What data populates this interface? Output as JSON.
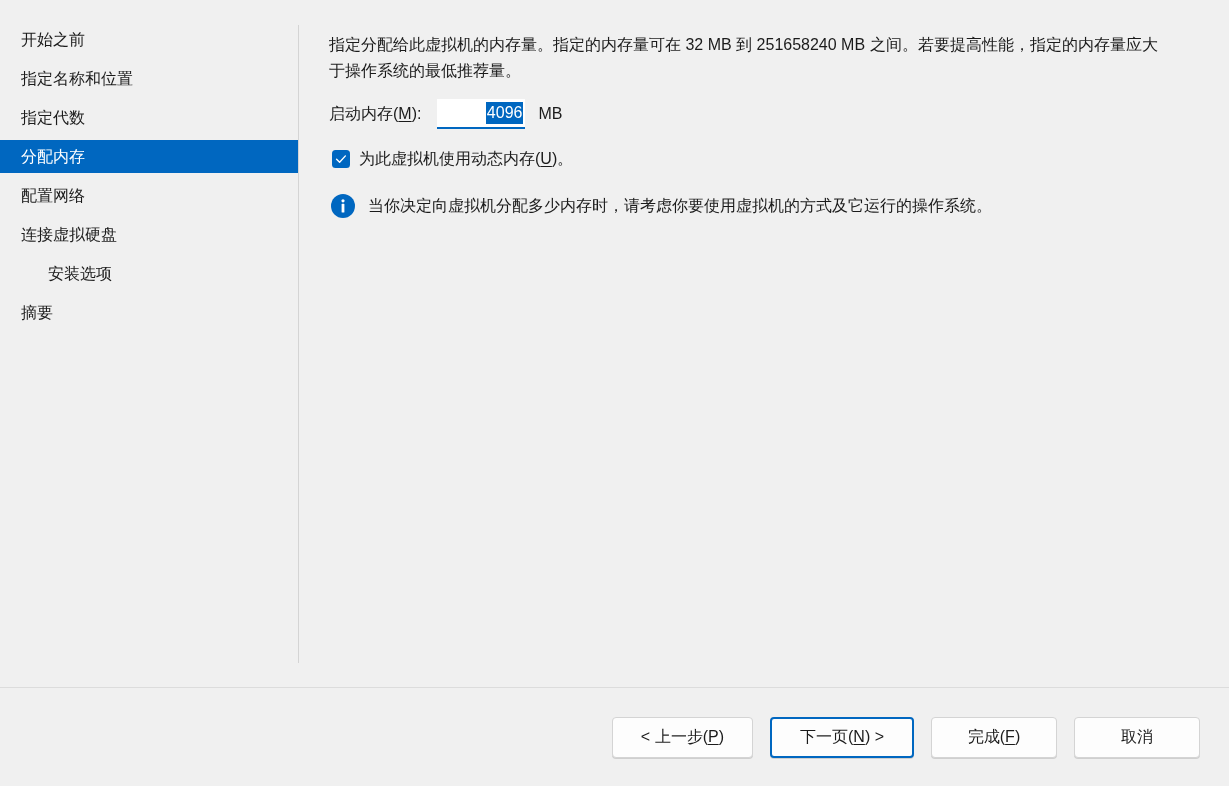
{
  "sidebar": {
    "items": [
      {
        "label": "开始之前",
        "selected": false
      },
      {
        "label": "指定名称和位置",
        "selected": false
      },
      {
        "label": "指定代数",
        "selected": false
      },
      {
        "label": "分配内存",
        "selected": true
      },
      {
        "label": "配置网络",
        "selected": false
      },
      {
        "label": "连接虚拟硬盘",
        "selected": false,
        "children": [
          {
            "label": "安装选项",
            "selected": false
          }
        ]
      },
      {
        "label": "摘要",
        "selected": false
      }
    ]
  },
  "description": "指定分配给此虚拟机的内存量。指定的内存量可在 32 MB 到 251658240 MB 之间。若要提高性能，指定的内存量应大于操作系统的最低推荐量。",
  "startup_memory": {
    "label": [
      {
        "text": "启动内存(",
        "access_key": false
      },
      {
        "text": "M",
        "access_key": true
      },
      {
        "text": "):",
        "access_key": false
      }
    ],
    "value": "4096",
    "value_highlighted": true,
    "unit": "MB"
  },
  "dynamic_memory": {
    "checked": true,
    "label": [
      {
        "text": "为此虚拟机使用动态内存(",
        "access_key": false
      },
      {
        "text": "U",
        "access_key": true
      },
      {
        "text": ")。",
        "access_key": false
      }
    ]
  },
  "info": {
    "text": "当你决定向虚拟机分配多少内存时，请考虑你要使用虚拟机的方式及它运行的操作系统。"
  },
  "buttons": [
    {
      "label": [
        {
          "text": "< 上一步(",
          "access_key": false
        },
        {
          "text": "P",
          "access_key": true
        },
        {
          "text": ")",
          "access_key": false
        }
      ],
      "default": false
    },
    {
      "label": [
        {
          "text": "下一页(",
          "access_key": false
        },
        {
          "text": "N",
          "access_key": true
        },
        {
          "text": ") >",
          "access_key": false
        }
      ],
      "default": true
    },
    {
      "label": [
        {
          "text": "完成(",
          "access_key": false
        },
        {
          "text": "F",
          "access_key": true
        },
        {
          "text": ")",
          "access_key": false
        }
      ],
      "default": false
    },
    {
      "label": [
        {
          "text": "取消",
          "access_key": false
        }
      ],
      "default": false
    }
  ]
}
